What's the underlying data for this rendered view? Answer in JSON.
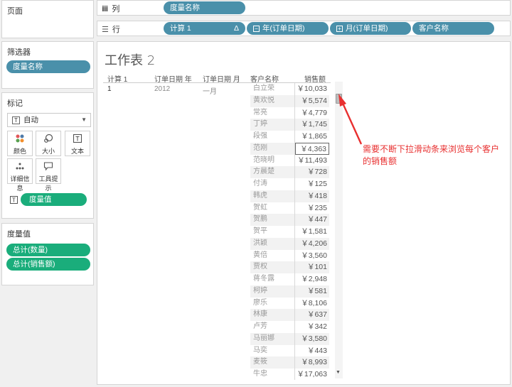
{
  "pages_panel": {
    "title": "页面"
  },
  "filters_panel": {
    "title": "筛选器",
    "pill": "度量名称"
  },
  "marks_panel": {
    "title": "标记",
    "mark_type": "自动",
    "buttons": [
      {
        "icon": "color-icon",
        "label": "颜色"
      },
      {
        "icon": "size-icon",
        "label": "大小"
      },
      {
        "icon": "text-icon",
        "label": "文本"
      },
      {
        "icon": "detail-icon",
        "label": "详细信息"
      },
      {
        "icon": "tooltip-icon",
        "label": "工具提示"
      }
    ],
    "text_pill": "度量值"
  },
  "measures_panel": {
    "title": "度量值",
    "pills": [
      "总计(数量)",
      "总计(销售额)"
    ]
  },
  "columns_shelf": {
    "label": "列",
    "pills": [
      "度量名称"
    ]
  },
  "rows_shelf": {
    "label": "行",
    "pills": [
      {
        "text": "计算 1",
        "delta": "Δ"
      },
      {
        "text": "年(订单日期)"
      },
      {
        "text": "月(订单日期)"
      },
      {
        "text": "客户名称"
      }
    ]
  },
  "worksheet": {
    "title": "工作表 2",
    "headers": [
      "计算 1",
      "订单日期 年",
      "订单日期 月",
      "客户名称",
      "销售额"
    ],
    "calc_value": "1",
    "year_value": "2012",
    "month_value": "一月",
    "rows": [
      {
        "customer": "白立荣",
        "sales": "￥10,033"
      },
      {
        "customer": "黄欢悦",
        "sales": "￥5,574"
      },
      {
        "customer": "常亮",
        "sales": "￥4,779"
      },
      {
        "customer": "丁婷",
        "sales": "￥1,745"
      },
      {
        "customer": "段强",
        "sales": "￥1,865"
      },
      {
        "customer": "范刚",
        "sales": "￥4,363"
      },
      {
        "customer": "范晓明",
        "sales": "￥11,493"
      },
      {
        "customer": "方晨楚",
        "sales": "￥728"
      },
      {
        "customer": "付涛",
        "sales": "￥125"
      },
      {
        "customer": "韩虎",
        "sales": "￥418"
      },
      {
        "customer": "贺虹",
        "sales": "￥235"
      },
      {
        "customer": "贺鹏",
        "sales": "￥447"
      },
      {
        "customer": "贺平",
        "sales": "￥1,581"
      },
      {
        "customer": "洪颖",
        "sales": "￥4,206"
      },
      {
        "customer": "黄倍",
        "sales": "￥3,560"
      },
      {
        "customer": "贾权",
        "sales": "￥101"
      },
      {
        "customer": "蒋冬露",
        "sales": "￥2,948"
      },
      {
        "customer": "柯婷",
        "sales": "￥581"
      },
      {
        "customer": "廖乐",
        "sales": "￥8,106"
      },
      {
        "customer": "林康",
        "sales": "￥637"
      },
      {
        "customer": "卢芳",
        "sales": "￥342"
      },
      {
        "customer": "马丽娜",
        "sales": "￥3,580"
      },
      {
        "customer": "马奕",
        "sales": "￥443"
      },
      {
        "customer": "麦筱",
        "sales": "￥8,993"
      },
      {
        "customer": "牛忠",
        "sales": "￥17,063"
      }
    ],
    "selected_row": 5
  },
  "annotation": {
    "text": "需要不断下拉滑动条来浏览每个客户的销售额"
  },
  "colors": {
    "measure_pill": "#4a90aa",
    "value_pill": "#1aad7b",
    "annotation": "#e83030"
  }
}
